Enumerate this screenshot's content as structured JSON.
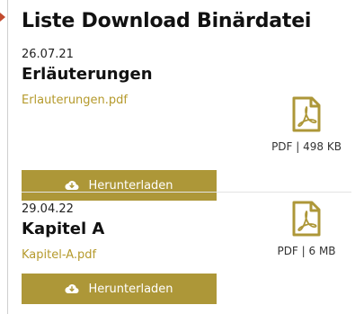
{
  "list": {
    "title": "Liste Download Binärdatei",
    "items": [
      {
        "date": "26.07.21",
        "title": "Erläuterungen",
        "filename": "Erlauterungen.pdf",
        "button_label": "Herunterladen",
        "file_info": "PDF | 498 KB",
        "icon": "pdf-file-icon"
      },
      {
        "date": "29.04.22",
        "title": "Kapitel A",
        "filename": "Kapitel-A.pdf",
        "button_label": "Herunterladen",
        "file_info": "PDF | 6 MB",
        "icon": "pdf-file-icon"
      }
    ]
  },
  "colors": {
    "accent": "#ad9738",
    "link": "#b59a2c",
    "marker": "#c24a2e"
  }
}
